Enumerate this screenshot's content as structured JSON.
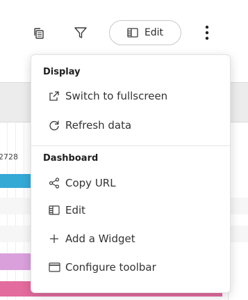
{
  "toolbar": {
    "edit_label": "Edit",
    "icons": {
      "copy": "copy-icon",
      "filter": "filter-icon",
      "edit": "sidebar-layout-icon",
      "more": "more-vertical-icon"
    }
  },
  "background": {
    "day_labels": [
      "27",
      "28"
    ],
    "bar_colors": {
      "blue": "#35a9d6",
      "lilac": "#d9a0dc",
      "pink": "#e36b9e"
    }
  },
  "menu": {
    "sections": [
      {
        "title": "Display",
        "items": [
          {
            "label": "Switch to fullscreen",
            "icon": "external-link-icon"
          },
          {
            "label": "Refresh data",
            "icon": "refresh-icon"
          }
        ]
      },
      {
        "title": "Dashboard",
        "items": [
          {
            "label": "Copy URL",
            "icon": "share-icon"
          },
          {
            "label": "Edit",
            "icon": "sidebar-layout-icon"
          },
          {
            "label": "Add a Widget",
            "icon": "plus-icon"
          },
          {
            "label": "Configure toolbar",
            "icon": "window-icon"
          }
        ]
      }
    ]
  }
}
